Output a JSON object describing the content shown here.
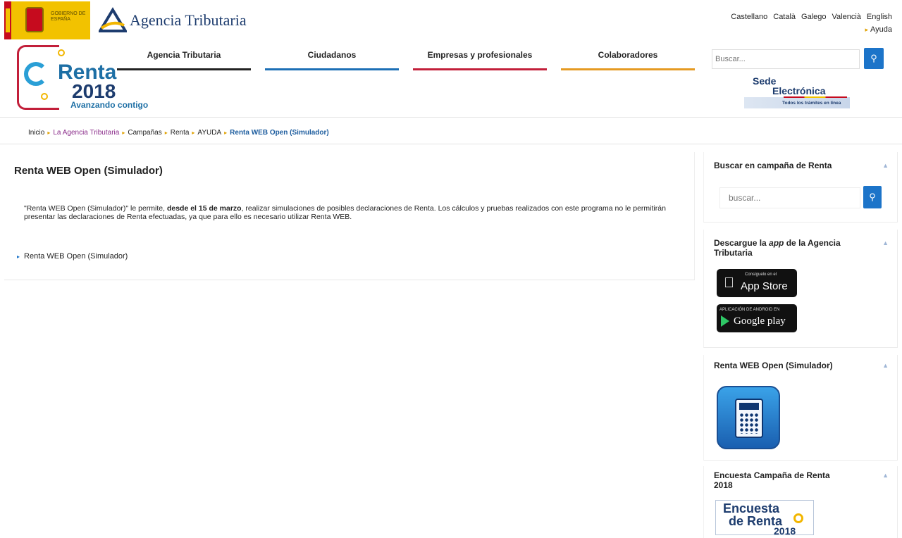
{
  "header": {
    "gov_text": "Gobierno de España",
    "brand": "Agencia Tributaria",
    "languages": [
      "Castellano",
      "Català",
      "Galego",
      "Valencià",
      "English"
    ],
    "help": "Ayuda",
    "search_placeholder": "Buscar...",
    "search_icon": "search-icon"
  },
  "campaign_logo": {
    "word": "Renta",
    "year": "2018",
    "slogan": "Avanzando contigo"
  },
  "nav": [
    {
      "label": "Agencia Tributaria",
      "color": "#222222"
    },
    {
      "label": "Ciudadanos",
      "color": "#1c6fb5"
    },
    {
      "label": "Empresas y profesionales",
      "color": "#c21f3a"
    },
    {
      "label": "Colaboradores",
      "color": "#e59a22"
    }
  ],
  "sede": {
    "line1": "Sede",
    "line2": "Electrónica",
    "subtitle": "Todos los trámites en línea"
  },
  "breadcrumb": [
    "Inicio",
    "La Agencia Tributaria",
    "Campañas",
    "Renta",
    "AYUDA",
    "Renta WEB Open (Simulador)"
  ],
  "main": {
    "title": "Renta WEB Open (Simulador)",
    "desc_part1": "\"Renta WEB Open (Simulador)\" le permite, ",
    "desc_bold": "desde el 15 de marzo",
    "desc_part2": ", realizar simulaciones de posibles declaraciones de Renta. Los cálculos y pruebas realizados con este programa no le permitirán presentar las declaraciones de Renta efectuadas, ya que para ello es necesario utilizar Renta WEB.",
    "link": "Renta WEB Open (Simulador)"
  },
  "sidebar": {
    "search_title": "Buscar en campaña de Renta",
    "search_placeholder": "buscar...",
    "app_title_1": "Descargue la ",
    "app_title_em": "app",
    "app_title_2": " de la Agencia Tributaria",
    "appstore_small": "Consíguelo en el",
    "appstore_big": "App Store",
    "googleplay_small": "APLICACIÓN DE ANDROID EN",
    "googleplay_big": "Google play",
    "simulator_title": "Renta WEB Open (Simulador)",
    "survey_title": "Encuesta Campaña de Renta 2018",
    "survey_img_line1": "Encuesta",
    "survey_img_line2": "de Renta",
    "survey_img_line3": "2018"
  },
  "colors": {
    "accent_blue": "#1c74c9",
    "brand_navy": "#1d3c6e",
    "brand_red": "#c21f3a",
    "brand_orange": "#e59a22"
  }
}
